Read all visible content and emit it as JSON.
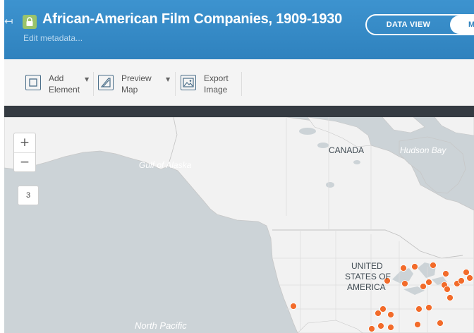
{
  "header": {
    "back_glyph": "↤",
    "lock_icon": "lock-icon",
    "title": "African-American Film Companies, 1909-1930",
    "edit_metadata": "Edit metadata...",
    "view_toggle": {
      "data_view_label": "DATA VIEW",
      "map_view_label": "M",
      "active": "map"
    }
  },
  "toolbar": {
    "add_element": {
      "label": "Add\nElement",
      "icon": "square-icon"
    },
    "preview_map": {
      "label": "Preview\nMap",
      "icon": "map-icon"
    },
    "export_image": {
      "label": "Export\nImage",
      "icon": "image-icon"
    }
  },
  "map": {
    "zoom_in": "+",
    "zoom_out": "−",
    "zoom_level": "3",
    "labels": {
      "canada": "CANADA",
      "hudson_bay": "Hudson Bay",
      "gulf_of_alaska": "Gulf of Alaska",
      "usa_line1": "UNITED",
      "usa_line2": "STATES OF",
      "usa_line3": "AMERICA",
      "north_pacific": "North Pacific"
    },
    "marker_color": "#f26b2a",
    "colors": {
      "land": "#f2f2f2",
      "water": "#ccd3d7",
      "accent": "#2f82be"
    }
  }
}
